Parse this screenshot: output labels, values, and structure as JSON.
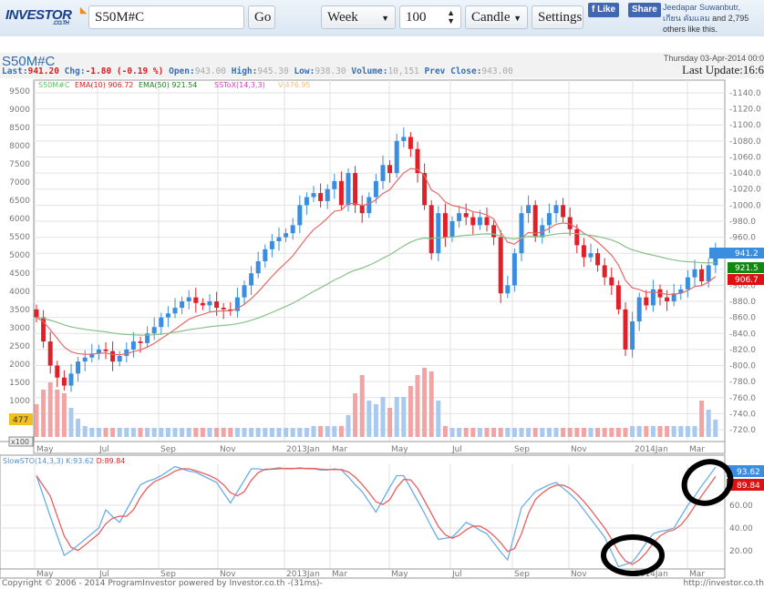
{
  "toolbar": {
    "logo": "INVESTOR",
    "logo_sub": ".CO.TH",
    "symbol_value": "S50M#C",
    "go_label": "Go",
    "period": "Week",
    "bars": "100",
    "chart_type": "Candle",
    "settings_label": "Settings",
    "like_label": "Like",
    "share_label": "Share",
    "fb_names": "Jeedapar Suwanbutr,",
    "fb_names2": "เกียน คัมแลม",
    "fb_suffix": "and 2,795",
    "fb_suffix2": "others like this."
  },
  "header": {
    "symbol": "S50M#C",
    "last_label": "Last:",
    "last": "941.20",
    "chg_label": "Chg:",
    "chg": "-1.80 (-0.19 %)",
    "open_label": "Open:",
    "open": "943.00",
    "high_label": "High:",
    "high": "945.30",
    "low_label": "Low:",
    "low": "938.30",
    "volume_label": "Volume:",
    "volume": "10,151",
    "prev_label": "Prev Close:",
    "prev": "943.00",
    "date": "Thursday 03-Apr-2014 00:0",
    "last_update": "Last Update:16:6"
  },
  "legend": {
    "symbol": "S50M#C",
    "ema10": "EMA(10) 906.72",
    "ema50": "EMA(50) 921.54",
    "ssto": "SSToX(14,3,3)",
    "vol": "V:476.95"
  },
  "badges": {
    "last": "941.2",
    "ema50": "921.5",
    "ema10": "906.7",
    "volume": "477",
    "vol_unit": "x100",
    "k": "93.62",
    "d": "89.84"
  },
  "stoch_legend": {
    "name": "SlowSTO(14,3,3)",
    "k": "K:93.62",
    "d": "D:89.84"
  },
  "footer": {
    "copyright": "Copyright © 2006 - 2014 ProgramInvestor powered by Investor.co.th -(31ms)-",
    "url": "http://investor.co.th"
  },
  "colors": {
    "up": "#3a8ee0",
    "down": "#e02028",
    "ema10": "#e86868",
    "ema50": "#88c088",
    "vol_up": "#a9c9ef",
    "vol_down": "#f2a4a4",
    "k": "#6aaee8",
    "d": "#e86060"
  },
  "chart_data": [
    {
      "type": "candlestick",
      "frequency": "week",
      "price_axis": {
        "range": [
          720,
          1140
        ],
        "ticks": [
          "1140.0",
          "1120.0",
          "1100.0",
          "1080.0",
          "1060.0",
          "1040.0",
          "1020.0",
          "1000.0",
          "980.0",
          "960.0",
          "940.0",
          "920.0",
          "900.0",
          "880.0",
          "860.0",
          "840.0",
          "820.0",
          "800.0",
          "780.0",
          "760.0",
          "740.0",
          "720.0"
        ]
      },
      "volume_axis": {
        "range": [
          0,
          9500
        ],
        "ticks": [
          "9500",
          "9000",
          "8500",
          "8000",
          "7500",
          "7000",
          "6500",
          "6000",
          "5500",
          "5000",
          "4500",
          "4000",
          "3500",
          "3000",
          "2500",
          "2000",
          "1500",
          "1000",
          "500"
        ]
      },
      "x_ticks": [
        "May",
        "Jul",
        "Sep",
        "Nov",
        "2013Jan",
        "Mar",
        "May",
        "Jul",
        "Sep",
        "Nov",
        "2014Jan",
        "Mar"
      ],
      "close": [
        860,
        830,
        800,
        785,
        775,
        790,
        805,
        810,
        815,
        820,
        818,
        805,
        812,
        820,
        830,
        828,
        840,
        848,
        860,
        865,
        872,
        880,
        885,
        878,
        875,
        880,
        872,
        870,
        868,
        885,
        900,
        915,
        930,
        945,
        955,
        960,
        965,
        975,
        1000,
        1010,
        1015,
        1005,
        1020,
        1030,
        1000,
        1040,
        1000,
        990,
        1010,
        1030,
        1050,
        1040,
        1080,
        1085,
        1070,
        1040,
        1000,
        940,
        990,
        960,
        980,
        990,
        985,
        975,
        985,
        975,
        960,
        890,
        900,
        940,
        990,
        1000,
        960,
        975,
        990,
        1000,
        985,
        970,
        950,
        935,
        940,
        925,
        910,
        900,
        870,
        820,
        855,
        885,
        875,
        895,
        885,
        880,
        890,
        895,
        910,
        920,
        905,
        925,
        941.2
      ],
      "volume": [
        900,
        1300,
        1500,
        1300,
        1200,
        800,
        500,
        300,
        250,
        250,
        250,
        250,
        250,
        250,
        250,
        250,
        250,
        250,
        250,
        250,
        250,
        250,
        250,
        250,
        250,
        250,
        250,
        250,
        250,
        250,
        250,
        250,
        250,
        250,
        250,
        250,
        250,
        250,
        250,
        250,
        300,
        300,
        300,
        300,
        300,
        600,
        1200,
        1700,
        1000,
        900,
        1100,
        800,
        1100,
        1100,
        1400,
        1700,
        1900,
        1800,
        1000,
        300,
        250,
        250,
        250,
        250,
        250,
        250,
        250,
        250,
        250,
        250,
        250,
        250,
        250,
        250,
        250,
        250,
        250,
        250,
        250,
        250,
        250,
        250,
        250,
        250,
        250,
        250,
        300,
        300,
        300,
        300,
        300,
        300,
        300,
        300,
        300,
        300,
        1000,
        750,
        477
      ]
    },
    {
      "type": "line",
      "name": "SlowSTO(14,3,3)",
      "y_range": [
        0,
        100
      ],
      "y_ticks": [
        "60.00",
        "40.00",
        "20.00"
      ],
      "k": [
        86,
        68,
        50,
        33,
        16,
        20,
        25,
        30,
        35,
        40,
        56,
        50,
        45,
        56,
        67,
        78,
        81,
        83,
        86,
        90,
        94,
        92,
        90,
        89,
        86,
        83,
        80,
        71,
        62,
        72,
        82,
        92,
        92,
        91,
        92,
        93,
        92,
        92,
        93,
        92,
        92,
        91,
        91,
        92,
        91,
        85,
        78,
        72,
        63,
        54,
        65,
        76,
        86,
        86,
        75,
        64,
        53,
        41,
        30,
        31,
        32,
        38,
        45,
        42,
        38,
        35,
        27,
        19,
        12,
        35,
        58,
        65,
        72,
        75,
        78,
        80,
        75,
        70,
        64,
        56,
        48,
        40,
        32,
        19,
        6,
        8,
        10,
        18,
        27,
        35,
        37,
        38,
        40,
        50,
        60,
        68,
        77,
        85,
        93.62
      ]
    }
  ]
}
